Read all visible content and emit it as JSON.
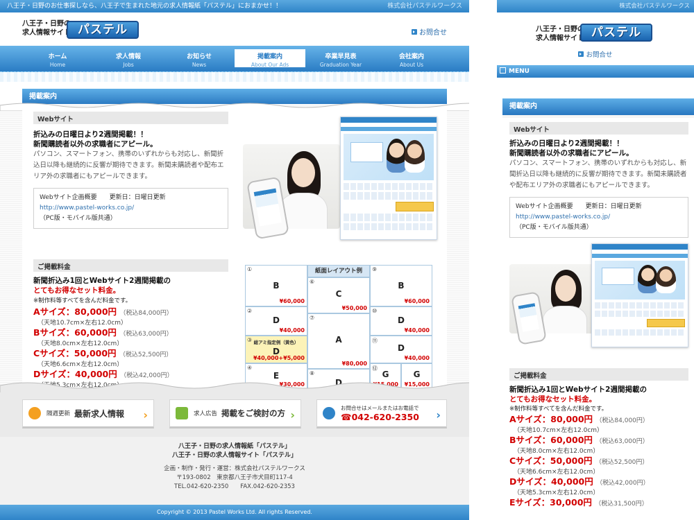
{
  "desktop": {
    "topbar": {
      "tagline": "八王子・日野のお仕事探しなら、八王子で生まれた地元の求人情報紙「パステル」におまかせ！！",
      "company": "株式会社パステルワークス"
    },
    "brand": {
      "sub_line1": "八王子・日野の",
      "sub_line2": "求人情報サイト",
      "logo_text": "パステル",
      "contact": "お問合せ"
    },
    "nav": [
      {
        "ja": "ホーム",
        "en": "Home"
      },
      {
        "ja": "求人情報",
        "en": "Jobs"
      },
      {
        "ja": "お知らせ",
        "en": "News"
      },
      {
        "ja": "掲載案内",
        "en": "About Our Ads"
      },
      {
        "ja": "卒業早見表",
        "en": "Graduation Year"
      },
      {
        "ja": "会社案内",
        "en": "About Us"
      }
    ],
    "section_title": "掲載案内",
    "website": {
      "heading": "Webサイト",
      "lead1": "折込みの日曜日より2週間掲載！！",
      "lead2": "新聞購読者以外の求職者にアピール。",
      "body": "パソコン、スマートフォン、携帯のいずれからも対応し、新聞折込日以降も継続的に反響が期待できます。新聞未購読者や配布エリア外の求職者にもアピールできます。",
      "box_title": "Webサイト企画概要　　更新日：日曜日更新",
      "box_url": "http://www.pastel-works.co.jp/",
      "box_note": "（PC版・モバイル版共通）"
    },
    "pricing": {
      "heading": "ご掲載料金",
      "lead1": "新聞折込み1回とWebサイト2週間掲載の",
      "lead2": "とてもお得なセット料金。",
      "note": "※制作料等すべてを含んだ料金です。",
      "items": [
        {
          "name": "Aサイズ：80,000円",
          "tax": "（税込84,000円）",
          "size": "（天地10.7cm×左右12.0cm）"
        },
        {
          "name": "Bサイズ：60,000円",
          "tax": "（税込63,000円）",
          "size": "（天地8.0cm×左右12.0cm）"
        },
        {
          "name": "Cサイズ：50,000円",
          "tax": "（税込52,500円）",
          "size": "（天地6.6cm×左右12.0cm）"
        },
        {
          "name": "Dサイズ：40,000円",
          "tax": "（税込42,000円）",
          "size": "（天地5.3cm×左右12.0cm）"
        }
      ]
    },
    "layout_grid": {
      "title": "紙面レイアウト例",
      "cells": [
        {
          "num": "①",
          "letter": "B",
          "price": "¥60,000"
        },
        {
          "num": "②",
          "letter": "D",
          "price": "¥40,000"
        },
        {
          "num": "③",
          "letter": "D",
          "price": "¥40,000+¥5,000",
          "note": "総アミ指定例（黄色）"
        },
        {
          "num": "④",
          "letter": "E",
          "price": "¥30,000"
        },
        {
          "num": "⑥",
          "letter": "C",
          "price": "¥50,000"
        },
        {
          "num": "⑦",
          "letter": "A",
          "price": "¥80,000"
        },
        {
          "num": "⑧",
          "letter": "D",
          "price": ""
        },
        {
          "num": "⑨",
          "letter": "B",
          "price": "¥60,000"
        },
        {
          "num": "⑩",
          "letter": "D",
          "price": "¥40,000"
        },
        {
          "num": "⑪",
          "letter": "D",
          "price": "¥40,000"
        },
        {
          "num": "⑫",
          "letter": "G",
          "price": "¥15,000"
        },
        {
          "num": "",
          "letter": "G",
          "price": "¥15,000"
        }
      ]
    },
    "banners": [
      {
        "small": "隔週更新",
        "big": "最新求人情報"
      },
      {
        "small": "求人広告",
        "big": "掲載をご検討の方"
      },
      {
        "small": "お問合せはメールまたはお電話で",
        "big": "042-620-2350"
      }
    ],
    "footer": {
      "line1": "八王子・日野の求人情報紙「パステル」",
      "line2": "八王子・日野の求人情報サイト「パステル」",
      "line3": "企画・制作・発行・運営：株式会社パステルワークス",
      "line4": "〒193-0802　東京都八王子市犬目町117-4",
      "line5": "TEL.042-620-2350　　FAX.042-620-2353",
      "copyright": "Copyright © 2013 Pastel Works Ltd. All rights Reserved."
    }
  },
  "mobile": {
    "topbar_company": "株式会社パステルワークス",
    "sub_line1": "八王子・日野の",
    "sub_line2": "求人情報サイト",
    "logo_text": "パステル",
    "contact": "お問合せ",
    "menu": "MENU",
    "section_title": "掲載案内",
    "website_heading": "Webサイト",
    "lead1": "折込みの日曜日より2週間掲載！！",
    "lead2": "新聞購読者以外の求職者にアピール。",
    "body": "パソコン、スマートフォン、携帯のいずれからも対応し、新聞折込日以降も継続的に反響が期待できます。新聞未購読者や配布エリア外の求職者にもアピールできます。",
    "box_title": "Webサイト企画概要　　更新日：日曜日更新",
    "box_url": "http://www.pastel-works.co.jp/",
    "box_note": "（PC版・モバイル版共通）",
    "pricing_heading": "ご掲載料金",
    "p_lead1": "新聞折込み1回とWebサイト2週間掲載の",
    "p_lead2": "とてもお得なセット料金。",
    "p_note": "※制作料等すべてを含んだ料金です。",
    "items": [
      {
        "name": "Aサイズ：80,000円",
        "tax": "（税込84,000円）",
        "size": "（天地10.7cm×左右12.0cm）"
      },
      {
        "name": "Bサイズ：60,000円",
        "tax": "（税込63,000円）",
        "size": "（天地8.0cm×左右12.0cm）"
      },
      {
        "name": "Cサイズ：50,000円",
        "tax": "（税込52,500円）",
        "size": "（天地6.6cm×左右12.0cm）"
      },
      {
        "name": "Dサイズ：40,000円",
        "tax": "（税込42,000円）",
        "size": "（天地5.3cm×左右12.0cm）"
      },
      {
        "name": "Eサイズ：30,000円",
        "tax": "（税込31,500円）",
        "size": ""
      }
    ]
  },
  "colors": {
    "brand_blue": "#2f84c8",
    "price_red": "#d20000",
    "logo_yellow": "#f6c400"
  }
}
